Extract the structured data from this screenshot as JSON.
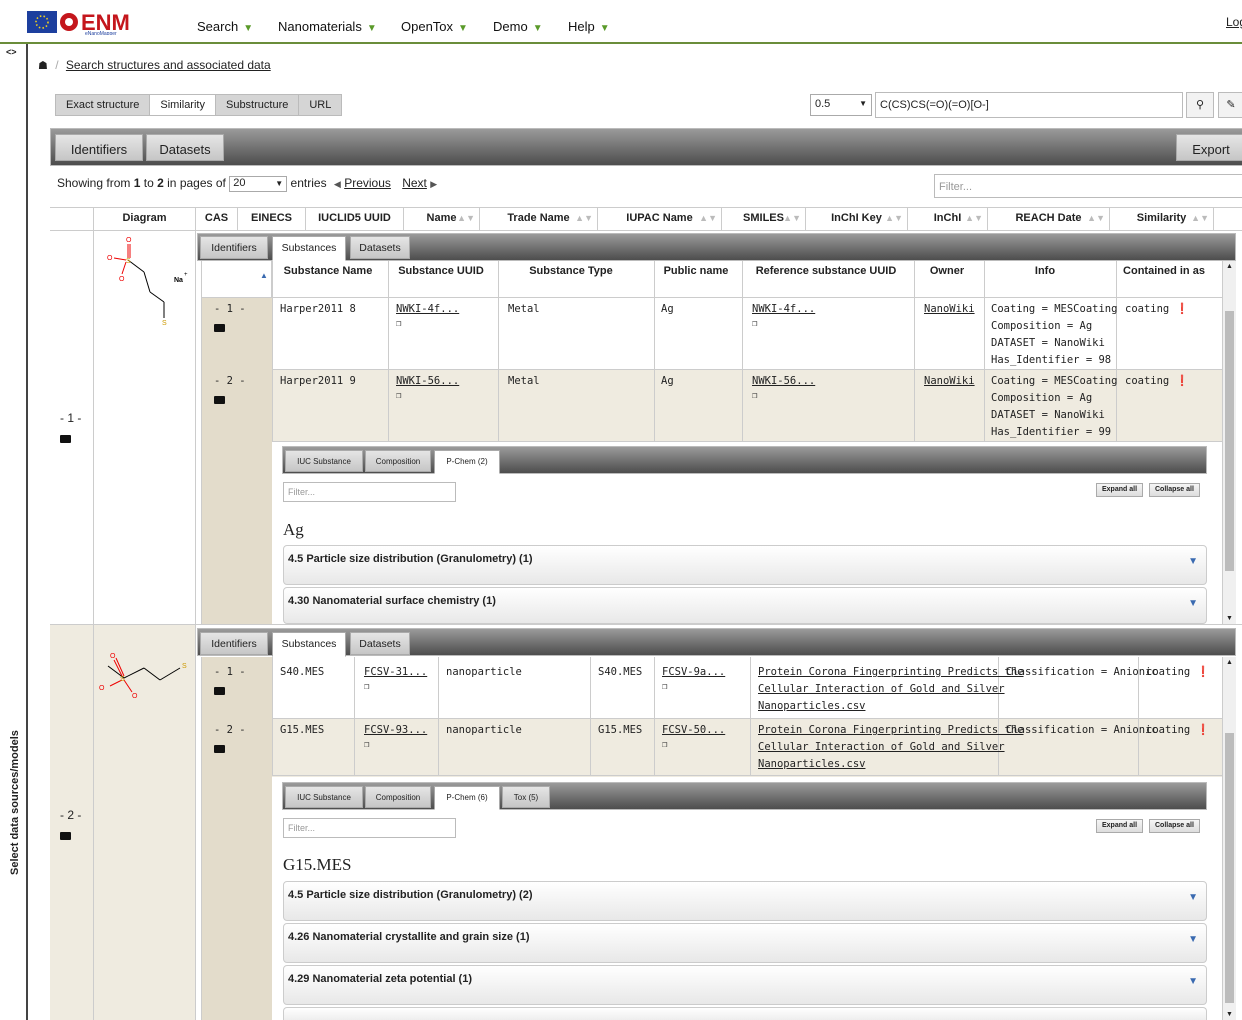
{
  "header": {
    "nav": [
      {
        "label": "Search",
        "caret": "▼"
      },
      {
        "label": "Nanomaterials",
        "caret": "▼"
      },
      {
        "label": "OpenTox",
        "caret": "▼"
      },
      {
        "label": "Demo",
        "caret": "▼"
      },
      {
        "label": "Help",
        "caret": "▼"
      }
    ],
    "login": "Log",
    "logo_text": "ENM",
    "logo_sub": "eNanoMapper"
  },
  "sidebar": {
    "toggle": "<>",
    "label": "Select data sources/models"
  },
  "breadcrumb": {
    "home_icon": "home-icon",
    "link": "Search structures and associated data"
  },
  "search": {
    "modes": [
      "Exact structure",
      "Similarity",
      "Substructure",
      "URL"
    ],
    "threshold": "0.5",
    "query": "C(CS)CS(=O)(=O)[O-]"
  },
  "main_tabs": {
    "identifiers": "Identifiers",
    "datasets": "Datasets",
    "export": "Export"
  },
  "paging": {
    "showing": "Showing from",
    "from": "1",
    "to_word": "to",
    "to": "2",
    "in_pages": "in pages of",
    "page_size": "20",
    "entries": "entries",
    "previous": "Previous",
    "next": "Next",
    "filter_placeholder": "Filter..."
  },
  "columns": [
    "Diagram",
    "CAS",
    "EINECS",
    "IUCLID5 UUID",
    "Name",
    "Trade Name",
    "IUPAC Name",
    "SMILES",
    "InChI Key",
    "InChI",
    "REACH Date",
    "Similarity"
  ],
  "sub_tabs": {
    "identifiers": "Identifiers",
    "substances": "Substances",
    "datasets": "Datasets"
  },
  "row1": {
    "num": "- 1 -",
    "sub_headers": [
      "Substance Name",
      "Substance UUID",
      "Substance Type",
      "Public name",
      "Reference substance UUID",
      "Owner",
      "Info",
      "Contained in as"
    ],
    "substances": [
      {
        "num": "- 1 -",
        "name": "Harper2011 8",
        "uuid": "NWKI-4f...",
        "type": "Metal",
        "public": "Ag",
        "ref": "NWKI-4f...",
        "owner": "NanoWiki",
        "info": [
          "Coating = MESCoating",
          "Composition = Ag",
          "DATASET = NanoWiki",
          "Has_Identifier = 98"
        ],
        "contained": "coating"
      },
      {
        "num": "- 2 -",
        "name": "Harper2011 9",
        "uuid": "NWKI-56...",
        "type": "Metal",
        "public": "Ag",
        "ref": "NWKI-56...",
        "owner": "NanoWiki",
        "info": [
          "Coating = MESCoating",
          "Composition = Ag",
          "DATASET = NanoWiki",
          "Has_Identifier = 99"
        ],
        "contained": "coating"
      }
    ],
    "detail_tabs": [
      "IUC Substance",
      "Composition",
      "P-Chem (2)"
    ],
    "filter": "Filter...",
    "expand": "Expand all",
    "collapse": "Collapse all",
    "heading": "Ag",
    "sections": [
      "4.5 Particle size distribution (Granulometry) (1)",
      "4.30 Nanomaterial surface chemistry (1)"
    ]
  },
  "row2": {
    "num": "- 2 -",
    "substances": [
      {
        "num": "- 1 -",
        "name": "S40.MES",
        "uuid": "FCSV-31...",
        "type": "nanoparticle",
        "public": "S40.MES",
        "ref": "FCSV-9a...",
        "owner": [
          "Protein Corona Fingerprinting Predicts the",
          "Cellular Interaction of Gold and Silver",
          "Nanoparticles.csv"
        ],
        "info": [
          "Classification = Anionic"
        ],
        "contained": "coating"
      },
      {
        "num": "- 2 -",
        "name": "G15.MES",
        "uuid": "FCSV-93...",
        "type": "nanoparticle",
        "public": "G15.MES",
        "ref": "FCSV-50...",
        "owner": [
          "Protein Corona Fingerprinting Predicts the",
          "Cellular Interaction of Gold and Silver",
          "Nanoparticles.csv"
        ],
        "info": [
          "Classification = Anionic"
        ],
        "contained": "coating"
      }
    ],
    "detail_tabs": [
      "IUC Substance",
      "Composition",
      "P-Chem (6)",
      "Tox (5)"
    ],
    "filter": "Filter...",
    "expand": "Expand all",
    "collapse": "Collapse all",
    "heading": "G15.MES",
    "sections": [
      "4.5 Particle size distribution (Granulometry) (2)",
      "4.26 Nanomaterial crystallite and grain size (1)",
      "4.29 Nanomaterial zeta potential (1)"
    ]
  },
  "molecule_labels": {
    "na": "Na"
  }
}
